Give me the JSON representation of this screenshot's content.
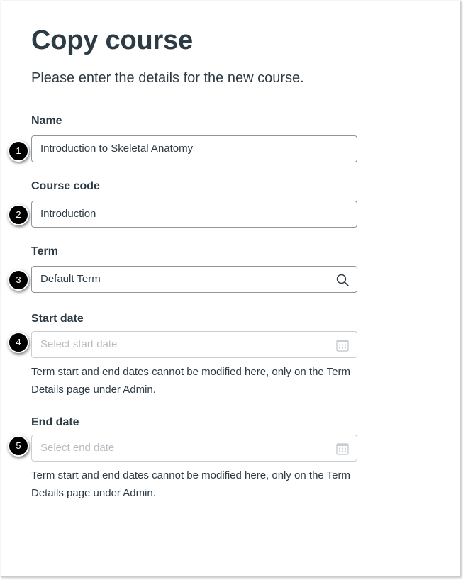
{
  "page": {
    "title": "Copy course",
    "subtitle": "Please enter the details for the new course."
  },
  "form": {
    "name": {
      "label": "Name",
      "value": "Introduction to Skeletal Anatomy",
      "marker": "1"
    },
    "course_code": {
      "label": "Course code",
      "value": "Introduction",
      "marker": "2"
    },
    "term": {
      "label": "Term",
      "value": "Default Term",
      "marker": "3",
      "icon": "search-icon"
    },
    "start_date": {
      "label": "Start date",
      "placeholder": "Select start date",
      "marker": "4",
      "icon": "calendar-icon",
      "help": "Term start and end dates cannot be modified here, only on the Term Details page under Admin."
    },
    "end_date": {
      "label": "End date",
      "placeholder": "Select end date",
      "marker": "5",
      "icon": "calendar-icon",
      "help": "Term start and end dates cannot be modified here, only on the Term Details page under Admin."
    }
  },
  "colors": {
    "text": "#2d3b45",
    "border": "#c7cdd1",
    "placeholder": "#b6bcc1",
    "marker": "#000000"
  }
}
